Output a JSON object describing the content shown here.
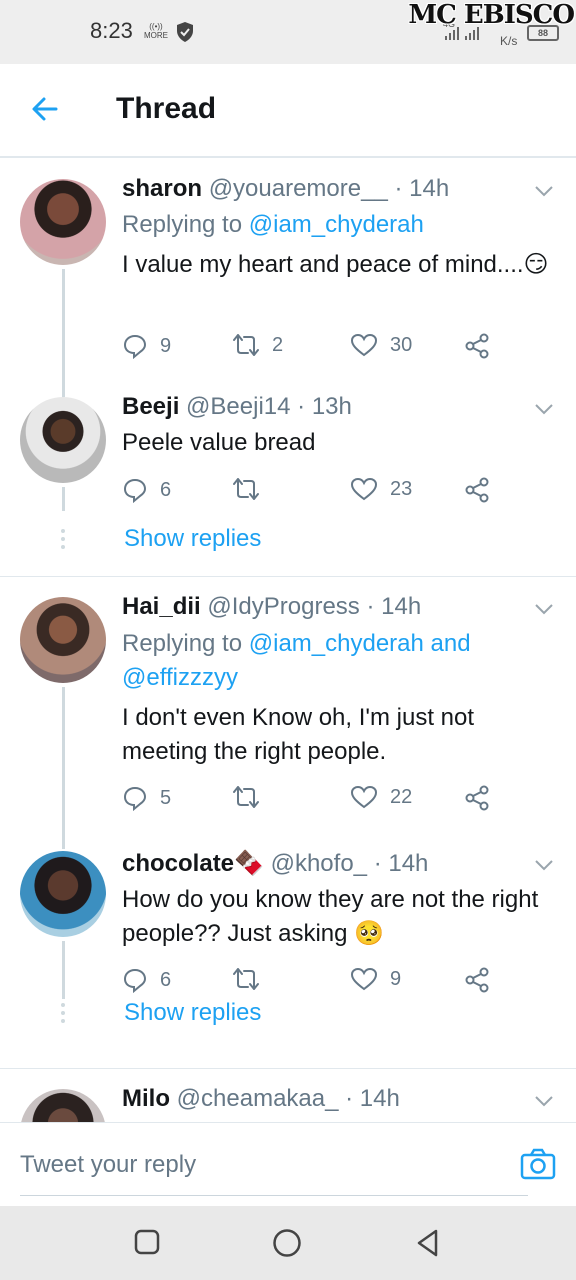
{
  "status_bar": {
    "time": "8:23",
    "more_label": "MORE",
    "network": "4G",
    "speed_value": "0",
    "speed_unit": "K/s",
    "battery": "88"
  },
  "watermark": "MC EBISCO",
  "app_bar": {
    "title": "Thread"
  },
  "tweets": [
    {
      "name": "sharon",
      "handle": "@youaremore__",
      "time": "· 14h",
      "replying_prefix": "Replying to ",
      "replying_to": "@iam_chyderah",
      "replying_to_2": "",
      "text": "I value my heart and peace of mind....😏",
      "replies": "9",
      "retweets": "2",
      "likes": "30"
    },
    {
      "name": "Beeji",
      "handle": "@Beeji14",
      "time": "· 13h",
      "text": "Peele value bread",
      "replies": "6",
      "retweets": "",
      "likes": "23"
    },
    {
      "name": "Hai_dii",
      "handle": "@IdyProgress",
      "time": "· 14h",
      "replying_prefix": "Replying to ",
      "replying_to": "@iam_chyderah and",
      "replying_to_2": "@effizzzyy",
      "text": "I don't even Know oh, I'm just not meeting the right people.",
      "replies": "5",
      "retweets": "",
      "likes": "22"
    },
    {
      "name": "chocolate🍫",
      "handle": "@khofo_",
      "time": "· 14h",
      "text": "How do you know they are not the right people?? Just asking 🥺",
      "replies": "6",
      "retweets": "",
      "likes": "9"
    },
    {
      "name": "Milo",
      "handle": "@cheamakaa_",
      "time": "· 14h"
    }
  ],
  "show_replies_label": "Show replies",
  "reply_bar": {
    "placeholder": "Tweet your reply"
  },
  "icons": [
    "back-arrow-icon",
    "chevron-down-icon",
    "reply-icon",
    "retweet-icon",
    "like-icon",
    "share-icon",
    "camera-icon",
    "square-nav-icon",
    "circle-nav-icon",
    "triangle-back-nav-icon",
    "shield-icon",
    "signal-icon",
    "battery-icon"
  ],
  "colors": {
    "accent": "#1da1f2",
    "muted": "#657786",
    "text": "#14171a",
    "divider": "#e1e8ed"
  }
}
